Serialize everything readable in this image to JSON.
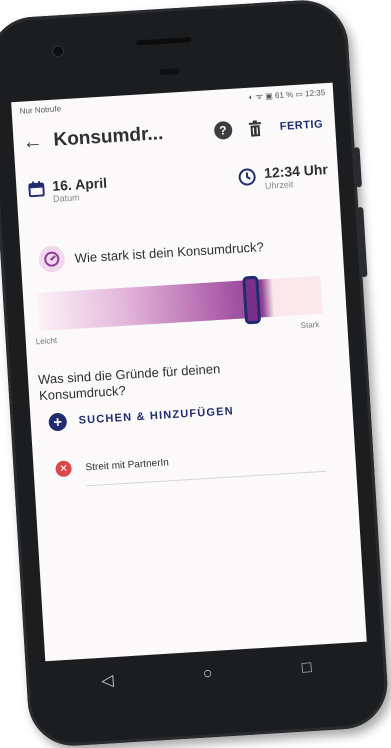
{
  "statusbar": {
    "left": "Nur Notrufe",
    "right": "◐ ᯤ ▣ 61 % ▭ 12:35"
  },
  "topbar": {
    "title": "Konsumdr...",
    "help": "?",
    "done_label": "FERTIG"
  },
  "date": {
    "value": "16. April",
    "label": "Datum"
  },
  "time": {
    "value": "12:34 Uhr",
    "label": "Uhrzeit"
  },
  "intensity": {
    "question": "Wie stark ist dein Konsumdruck?",
    "min_label": "Leicht",
    "max_label": "Stark",
    "level_fraction": 0.77
  },
  "reasons": {
    "question": "Was sind die Gründe für deinen Konsumdruck?",
    "add_label": "SUCHEN & HINZUFÜGEN",
    "items": [
      {
        "label": "Streit mit PartnerIn"
      }
    ]
  },
  "colors": {
    "accent": "#1f2d6e",
    "slider_purple": "#8d3f93",
    "remove_red": "#d84a4a"
  },
  "nav": {
    "back": "◁",
    "home": "○",
    "recents": "□"
  }
}
